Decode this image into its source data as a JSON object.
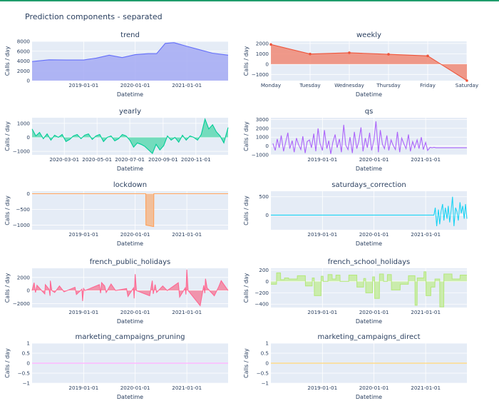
{
  "figure": {
    "title": "Prediction components - separated"
  },
  "chart_data": [
    {
      "id": "trend",
      "type": "area",
      "title": "trend",
      "xlabel": "Datetime",
      "ylabel": "Calls / day",
      "color": "#636efa",
      "fill_color": "#a5aaf3",
      "x_axis": "date",
      "xlim": [
        "2018-01-01",
        "2021-10-20"
      ],
      "xticks": [
        "2019-01-01",
        "2020-01-01",
        "2021-01-01"
      ],
      "ylim": [
        0,
        8000
      ],
      "yticks": [
        0,
        2000,
        4000,
        6000,
        8000
      ],
      "yticklabels": [
        "0",
        "2000",
        "4000",
        "6000",
        "8000"
      ],
      "x": [
        "2018-01-01",
        "2018-05-01",
        "2018-09-01",
        "2019-01-01",
        "2019-04-01",
        "2019-07-01",
        "2019-10-01",
        "2020-01-01",
        "2020-04-01",
        "2020-06-01",
        "2020-08-01",
        "2020-10-01",
        "2021-01-01",
        "2021-04-01",
        "2021-07-01",
        "2021-10-20"
      ],
      "y": [
        3900,
        4250,
        4200,
        4200,
        4600,
        5200,
        4700,
        5300,
        5500,
        5500,
        7600,
        7750,
        7000,
        6300,
        5600,
        5200
      ]
    },
    {
      "id": "weekly",
      "type": "area-markers",
      "title": "weekly",
      "xlabel": "Datetime",
      "ylabel": "Calls / day",
      "color": "#ef553b",
      "fill_color": "#f08a76",
      "categories": [
        "Monday",
        "Tuesday",
        "Wednesday",
        "Thursday",
        "Friday",
        "Saturday"
      ],
      "values": [
        1900,
        980,
        1100,
        950,
        800,
        -1600
      ],
      "ylim": [
        -1600,
        2200
      ],
      "yticks": [
        -1000,
        0,
        1000,
        2000
      ],
      "yticklabels": [
        "−1000",
        "0",
        "1000",
        "2000"
      ]
    },
    {
      "id": "yearly",
      "type": "area",
      "title": "yearly",
      "xlabel": "Datetime",
      "ylabel": "Calls / day",
      "color": "#00cc96",
      "fill_color": "#5fd9b3",
      "x_axis": "date",
      "xlim": [
        "2020-01-01",
        "2020-12-31"
      ],
      "xticks": [
        "2020-03-01",
        "2020-05-01",
        "2020-07-01",
        "2020-09-01",
        "2020-11-01"
      ],
      "ylim": [
        -1250,
        1400
      ],
      "yticks": [
        -1000,
        0,
        1000
      ],
      "yticklabels": [
        "−1000",
        "0",
        "1000"
      ],
      "x": [
        "2020-01-01",
        "2020-01-08",
        "2020-01-15",
        "2020-01-22",
        "2020-01-29",
        "2020-02-05",
        "2020-02-12",
        "2020-02-19",
        "2020-02-26",
        "2020-03-04",
        "2020-03-11",
        "2020-03-18",
        "2020-03-25",
        "2020-04-01",
        "2020-04-08",
        "2020-04-15",
        "2020-04-22",
        "2020-04-29",
        "2020-05-06",
        "2020-05-13",
        "2020-05-20",
        "2020-05-27",
        "2020-06-03",
        "2020-06-10",
        "2020-06-17",
        "2020-06-24",
        "2020-07-01",
        "2020-07-08",
        "2020-07-15",
        "2020-07-22",
        "2020-07-29",
        "2020-08-05",
        "2020-08-12",
        "2020-08-19",
        "2020-08-26",
        "2020-09-02",
        "2020-09-09",
        "2020-09-16",
        "2020-09-23",
        "2020-09-30",
        "2020-10-07",
        "2020-10-14",
        "2020-10-21",
        "2020-10-28",
        "2020-11-04",
        "2020-11-11",
        "2020-11-18",
        "2020-11-25",
        "2020-12-02",
        "2020-12-09",
        "2020-12-16",
        "2020-12-23",
        "2020-12-31"
      ],
      "y": [
        600,
        100,
        350,
        -100,
        250,
        -200,
        150,
        0,
        200,
        -300,
        -150,
        100,
        200,
        -100,
        150,
        250,
        -150,
        100,
        200,
        -300,
        0,
        100,
        -250,
        -100,
        200,
        100,
        -200,
        -700,
        -400,
        -500,
        -650,
        -900,
        -1150,
        -500,
        -900,
        -600,
        100,
        -200,
        0,
        -350,
        150,
        -200,
        100,
        0,
        -200,
        200,
        1300,
        600,
        900,
        400,
        100,
        -400,
        700
      ]
    },
    {
      "id": "qs",
      "type": "line",
      "title": "qs",
      "xlabel": "Datetime",
      "ylabel": "Calls / day",
      "color": "#ab63fa",
      "x_axis": "date",
      "xlim": [
        "2018-01-01",
        "2021-10-20"
      ],
      "xticks": [
        "2019-01-01",
        "2020-01-01",
        "2021-01-01"
      ],
      "ylim": [
        -1000,
        3200
      ],
      "yticks": [
        -1000,
        0,
        1000,
        2000,
        3000
      ],
      "yticklabels": [
        "−1000",
        "0",
        "1000",
        "2000",
        "3000"
      ],
      "x": [
        "2018-01-15",
        "2018-02-01",
        "2018-02-15",
        "2018-03-01",
        "2018-03-15",
        "2018-04-01",
        "2018-04-15",
        "2018-05-01",
        "2018-05-15",
        "2018-06-01",
        "2018-06-15",
        "2018-07-01",
        "2018-07-15",
        "2018-08-01",
        "2018-08-15",
        "2018-09-01",
        "2018-09-15",
        "2018-10-01",
        "2018-10-15",
        "2018-11-01",
        "2018-11-15",
        "2018-12-01",
        "2018-12-15",
        "2019-01-01",
        "2019-01-15",
        "2019-02-01",
        "2019-02-15",
        "2019-03-01",
        "2019-03-15",
        "2019-04-01",
        "2019-04-15",
        "2019-05-01",
        "2019-05-15",
        "2019-06-01",
        "2019-06-15",
        "2019-07-01",
        "2019-07-15",
        "2019-08-01",
        "2019-08-15",
        "2019-09-01",
        "2019-09-15",
        "2019-10-01",
        "2019-10-15",
        "2019-11-01",
        "2019-11-15",
        "2019-12-01",
        "2019-12-15",
        "2020-01-01",
        "2020-01-15",
        "2020-02-01",
        "2020-02-15",
        "2020-03-01",
        "2020-03-15",
        "2020-04-01",
        "2020-04-15",
        "2020-05-01",
        "2020-05-15",
        "2020-06-01",
        "2020-06-15",
        "2020-07-01",
        "2020-07-15",
        "2020-08-01",
        "2020-08-15",
        "2020-09-01",
        "2020-09-15",
        "2020-10-01",
        "2020-10-15",
        "2020-11-01",
        "2020-11-15",
        "2020-12-01",
        "2020-12-15",
        "2021-01-01",
        "2021-01-15",
        "2021-02-01",
        "2021-02-15",
        "2021-03-01",
        "2021-03-15",
        "2021-04-01",
        "2021-10-20"
      ],
      "y": [
        300,
        -500,
        800,
        -200,
        1200,
        -600,
        400,
        1500,
        -300,
        600,
        -700,
        900,
        200,
        -400,
        1100,
        -800,
        500,
        700,
        -200,
        1400,
        -600,
        2000,
        300,
        -500,
        1800,
        -300,
        600,
        -900,
        400,
        1300,
        -200,
        800,
        -700,
        2400,
        100,
        -400,
        1000,
        -800,
        1600,
        -300,
        500,
        2100,
        -600,
        900,
        -200,
        1500,
        -500,
        700,
        2800,
        -700,
        1800,
        200,
        -300,
        1200,
        -500,
        700,
        100,
        -400,
        1600,
        -700,
        900,
        200,
        -300,
        1300,
        -600,
        500,
        -200,
        700,
        -300,
        1000,
        -400,
        400,
        -500,
        -150,
        -200,
        -150,
        -200,
        -200,
        -200
      ]
    },
    {
      "id": "lockdown",
      "type": "area",
      "title": "lockdown",
      "xlabel": "Datetime",
      "ylabel": "Calls / day",
      "color": "#ffa15a",
      "fill_color": "#f4b789",
      "x_axis": "date",
      "xlim": [
        "2018-01-01",
        "2021-10-20"
      ],
      "xticks": [
        "2019-01-01",
        "2020-01-01",
        "2021-01-01"
      ],
      "ylim": [
        -1150,
        80
      ],
      "yticks": [
        -1000,
        -500,
        0
      ],
      "yticklabels": [
        "−1000",
        "−500",
        "0"
      ],
      "x": [
        "2018-01-01",
        "2020-03-16",
        "2020-03-17",
        "2020-05-11",
        "2020-05-12",
        "2021-10-20"
      ],
      "y": [
        0,
        0,
        -1000,
        -1050,
        0,
        0
      ]
    },
    {
      "id": "saturdays_correction",
      "type": "line",
      "title": "saturdays_correction",
      "xlabel": "Datetime",
      "ylabel": "Calls / day",
      "color": "#19d3f3",
      "x_axis": "date",
      "xlim": [
        "2018-01-01",
        "2021-10-20"
      ],
      "xticks": [
        "2019-01-01",
        "2020-01-01",
        "2021-01-01"
      ],
      "ylim": [
        -400,
        650
      ],
      "yticks": [
        0,
        500
      ],
      "yticklabels": [
        "0",
        "500"
      ],
      "x": [
        "2018-01-01",
        "2021-03-01",
        "2021-03-10",
        "2021-03-20",
        "2021-04-01",
        "2021-04-10",
        "2021-04-20",
        "2021-05-01",
        "2021-05-10",
        "2021-05-20",
        "2021-06-01",
        "2021-06-10",
        "2021-06-20",
        "2021-07-01",
        "2021-07-10",
        "2021-07-20",
        "2021-08-01",
        "2021-08-10",
        "2021-08-20",
        "2021-09-01",
        "2021-09-10",
        "2021-09-20",
        "2021-10-01",
        "2021-10-10",
        "2021-10-20"
      ],
      "y": [
        0,
        0,
        200,
        -300,
        150,
        -250,
        100,
        300,
        -150,
        200,
        -100,
        250,
        -200,
        150,
        500,
        -300,
        200,
        100,
        -150,
        350,
        50,
        250,
        -100,
        300,
        -100
      ]
    },
    {
      "id": "french_public_holidays",
      "type": "area",
      "title": "french_public_holidays",
      "xlabel": "Datetime",
      "ylabel": "Calls / day",
      "color": "#ff6692",
      "fill_color": "#f2859f",
      "x_axis": "date",
      "xlim": [
        "2018-01-01",
        "2021-10-20"
      ],
      "xticks": [
        "2019-01-01",
        "2020-01-01",
        "2021-01-01"
      ],
      "ylim": [
        -2600,
        3400
      ],
      "yticks": [
        -2000,
        0,
        2000
      ],
      "yticklabels": [
        "−2000",
        "0",
        "2000"
      ],
      "x": [
        "2018-01-01",
        "2018-01-15",
        "2018-01-25",
        "2018-02-05",
        "2018-03-10",
        "2018-04-01",
        "2018-04-05",
        "2018-05-01",
        "2018-05-08",
        "2018-05-10",
        "2018-05-21",
        "2018-06-10",
        "2018-07-14",
        "2018-08-15",
        "2018-11-01",
        "2018-11-11",
        "2018-12-20",
        "2018-12-25",
        "2019-01-01",
        "2019-01-10",
        "2019-04-22",
        "2019-05-01",
        "2019-05-08",
        "2019-05-30",
        "2019-06-10",
        "2019-07-14",
        "2019-08-15",
        "2019-11-01",
        "2019-11-11",
        "2019-12-20",
        "2019-12-25",
        "2020-01-01",
        "2020-01-10",
        "2020-04-13",
        "2020-05-01",
        "2020-05-08",
        "2020-05-21",
        "2020-06-01",
        "2020-07-14",
        "2020-08-15",
        "2020-11-01",
        "2020-11-11",
        "2020-12-20",
        "2020-12-25",
        "2021-01-01",
        "2021-01-10",
        "2021-04-05",
        "2021-05-01",
        "2021-05-08",
        "2021-05-13",
        "2021-05-24",
        "2021-07-14",
        "2021-08-15",
        "2021-09-01",
        "2021-10-20"
      ],
      "y": [
        0,
        1200,
        -300,
        800,
        0,
        -500,
        900,
        200,
        -800,
        1500,
        0,
        -300,
        700,
        -200,
        500,
        -600,
        200,
        -1600,
        300,
        0,
        900,
        -400,
        1200,
        700,
        -300,
        1000,
        0,
        300,
        -900,
        400,
        -1200,
        2500,
        0,
        -800,
        1500,
        -500,
        900,
        -300,
        700,
        0,
        1200,
        -1000,
        400,
        -600,
        3200,
        0,
        -2300,
        800,
        -400,
        1800,
        400,
        -800,
        600,
        1500,
        0
      ]
    },
    {
      "id": "french_school_holidays",
      "type": "area",
      "title": "french_school_holidays",
      "xlabel": "Datetime",
      "ylabel": "Calls / day",
      "color": "#b6e880",
      "fill_color": "#c6ec9f",
      "x_axis": "date",
      "xlim": [
        "2018-01-01",
        "2021-10-20"
      ],
      "xticks": [
        "2019-01-01",
        "2020-01-01",
        "2021-01-01"
      ],
      "ylim": [
        -460,
        230
      ],
      "yticks": [
        -400,
        -200,
        0,
        200
      ],
      "yticklabels": [
        "−400",
        "−200",
        "0",
        "200"
      ],
      "x": [
        "2018-01-01",
        "2018-02-10",
        "2018-02-11",
        "2018-03-10",
        "2018-03-11",
        "2018-04-07",
        "2018-04-08",
        "2018-05-06",
        "2018-05-07",
        "2018-07-07",
        "2018-07-08",
        "2018-09-02",
        "2018-09-03",
        "2018-10-20",
        "2018-10-21",
        "2018-11-04",
        "2018-11-05",
        "2018-12-22",
        "2018-12-23",
        "2019-01-06",
        "2019-01-07",
        "2019-02-09",
        "2019-02-10",
        "2019-03-10",
        "2019-03-11",
        "2019-04-06",
        "2019-04-07",
        "2019-05-05",
        "2019-05-06",
        "2019-07-06",
        "2019-07-07",
        "2019-09-01",
        "2019-09-02",
        "2019-10-19",
        "2019-10-20",
        "2019-11-03",
        "2019-11-04",
        "2019-12-21",
        "2019-12-22",
        "2020-01-05",
        "2020-01-06",
        "2020-02-08",
        "2020-02-09",
        "2020-03-08",
        "2020-03-09",
        "2020-04-04",
        "2020-04-05",
        "2020-05-03",
        "2020-05-04",
        "2020-07-04",
        "2020-07-05",
        "2020-08-31",
        "2020-09-01",
        "2020-10-17",
        "2020-10-18",
        "2020-11-01",
        "2020-11-02",
        "2020-12-19",
        "2020-12-20",
        "2021-01-03",
        "2021-01-04",
        "2021-02-06",
        "2021-02-07",
        "2021-03-07",
        "2021-03-08",
        "2021-04-10",
        "2021-04-11",
        "2021-05-09",
        "2021-05-10",
        "2021-07-06",
        "2021-07-07",
        "2021-09-01",
        "2021-09-02",
        "2021-10-20"
      ],
      "y": [
        -50,
        -50,
        150,
        150,
        30,
        30,
        60,
        60,
        40,
        40,
        100,
        100,
        -80,
        -80,
        60,
        60,
        -250,
        -250,
        90,
        90,
        0,
        0,
        120,
        120,
        40,
        40,
        110,
        110,
        0,
        0,
        110,
        110,
        -100,
        -100,
        50,
        50,
        -200,
        -200,
        80,
        80,
        -300,
        -300,
        130,
        130,
        0,
        0,
        120,
        120,
        -150,
        -150,
        -50,
        -50,
        100,
        100,
        -420,
        -420,
        60,
        60,
        170,
        170,
        -250,
        -250,
        -100,
        -100,
        40,
        40,
        -450,
        -450,
        130,
        130,
        40,
        40,
        110,
        110
      ]
    },
    {
      "id": "marketing_campaigns_pruning",
      "type": "line",
      "title": "marketing_campaigns_pruning",
      "xlabel": "Datetime",
      "ylabel": "Calls / day",
      "color": "#ff97ff",
      "x_axis": "date",
      "xlim": [
        "2018-01-01",
        "2021-10-20"
      ],
      "xticks": [
        "2019-01-01",
        "2020-01-01",
        "2021-01-01"
      ],
      "ylim": [
        -1,
        1
      ],
      "yticks": [
        -1,
        -0.5,
        0,
        0.5,
        1
      ],
      "yticklabels": [
        "−1",
        "−0.5",
        "0",
        "0.5",
        "1"
      ],
      "x": [
        "2018-01-01",
        "2021-10-20"
      ],
      "y": [
        0,
        0
      ]
    },
    {
      "id": "marketing_campaigns_direct",
      "type": "line",
      "title": "marketing_campaigns_direct",
      "xlabel": "Datetime",
      "ylabel": "Calls / day",
      "color": "#fecb52",
      "x_axis": "date",
      "xlim": [
        "2018-01-01",
        "2021-10-20"
      ],
      "xticks": [
        "2019-01-01",
        "2020-01-01",
        "2021-01-01"
      ],
      "ylim": [
        -1,
        1
      ],
      "yticks": [
        -1,
        -0.5,
        0,
        0.5,
        1
      ],
      "yticklabels": [
        "−1",
        "−0.5",
        "0",
        "0.5",
        "1"
      ],
      "x": [
        "2018-01-01",
        "2021-10-20"
      ],
      "y": [
        0,
        0
      ]
    }
  ]
}
